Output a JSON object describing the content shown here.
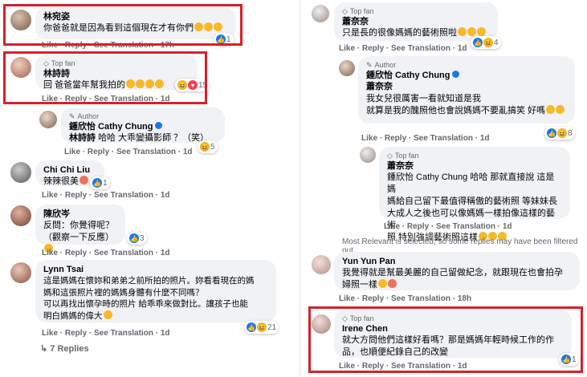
{
  "left": {
    "c1": {
      "name": "林宛姿",
      "text": "你爸爸就是因為看到這個現在才有你們",
      "actions": "Like · Reply · See Translation · 17h",
      "count": "1"
    },
    "c2": {
      "badge": "Top fan",
      "name": "林詩詩",
      "text": "回 爸爸當年幫我拍的",
      "actions": "Like · Reply · See Translation · 1d",
      "count": "15"
    },
    "c3": {
      "badge": "Author",
      "name": "鍾欣怡 Cathy Chung",
      "mention": "林詩詩",
      "text": "哈哈 大乖變攝影師 ？（笑）",
      "actions": "Like · Reply · See Translation · 1d",
      "count": "5"
    },
    "c4": {
      "name": "Chi Chi Liu",
      "text": "辣辣很美",
      "actions": "Like · Reply · See Translation · 1d",
      "count": "1"
    },
    "c5": {
      "name": "陳欣岑",
      "text": "反問：你覺得呢？\n（觀察一下反應）",
      "actions": "Like · Reply · See Translation · 1d",
      "count": "3"
    },
    "c6": {
      "name": "Lynn Tsai",
      "text": "這是媽媽在懷妳和弟弟之前所拍的照片。妳看看現在的媽\n媽和這張照片裡的媽媽身體有什麼不同嗎？\n可以再找出懷孕時的照片 給乖乖來做對比。讓孩子也能\n明白媽媽的偉大",
      "actions": "Like · Reply · See Translation · 1d",
      "count": "21"
    },
    "more": "7 Replies"
  },
  "right": {
    "c1": {
      "badge": "Top fan",
      "name": "蕭奈奈",
      "text": "只是長的很像媽媽的藝術照啦",
      "actions": "Like · Reply · See Translation · 1d",
      "count": "4"
    },
    "c2": {
      "badge": "Author",
      "name": "鍾欣怡 Cathy Chung",
      "mention": "蕭奈奈",
      "text": "我女兒很厲害一看就知道是我\n就算是我的醜照他也會說媽媽不要亂搞笑 好嗎",
      "actions": "Like · Reply · See Translation · 1d",
      "count": "8"
    },
    "c3": {
      "badge": "Top fan",
      "name": "蕭奈奈",
      "text": "鍾欣怡 Cathy Chung 哈哈 那就直接說 這是媽\n媽給自己留下最值得稱傲的藝術照 等妹妹長\n大成人之後也可以像媽媽一樣拍像這樣的藝術\n照 特別強調藝術照這樣",
      "actions": "Like · Reply · See Translation · 1d"
    },
    "note": "Most Relevant is selected, so some replies may have been filtered out.",
    "c4": {
      "name": "Yun Yun Pan",
      "text": "我覺得就是幫最美麗的自己留做紀念，就跟現在也會拍孕\n婦照一樣",
      "actions": "Like · Reply · See Translation · 18h"
    },
    "c5": {
      "badge": "Top fan",
      "name": "Irene Chen",
      "text": "就大方問他們這樣好看嗎？那是媽媽年輕時候工作的作\n品，也順便紀錄自己的改變",
      "actions": "Like · Reply · See Translation · 1d",
      "count": "1"
    }
  },
  "colors": {
    "highlight": "#d8202a",
    "bubble": "#f0f2f5",
    "like": "#1877f2"
  }
}
